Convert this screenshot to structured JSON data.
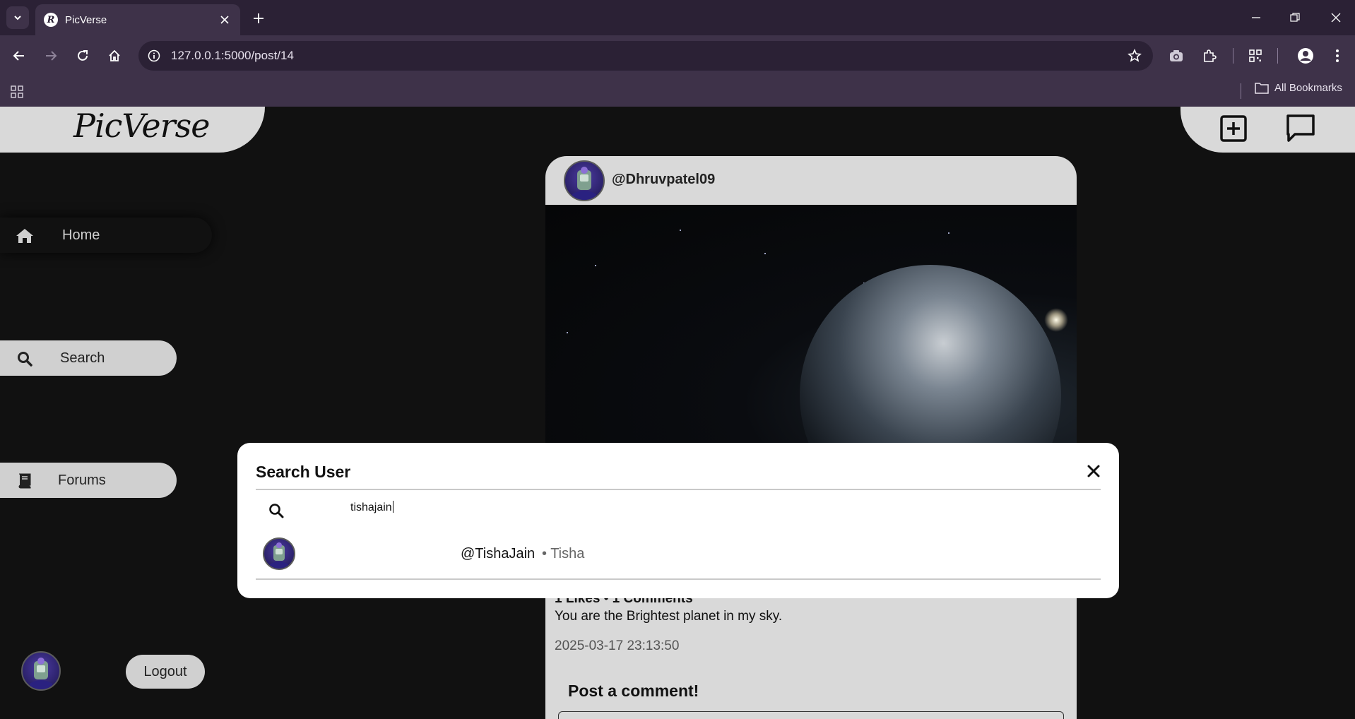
{
  "browser": {
    "tab_title": "PicVerse",
    "url": "127.0.0.1:5000/post/14",
    "all_bookmarks": "All Bookmarks"
  },
  "app": {
    "logo": "PicVerse",
    "nav": {
      "home": "Home",
      "search": "Search",
      "forums": "Forums"
    },
    "logout": "Logout"
  },
  "post": {
    "username": "@Dhruvpatel09",
    "counts": "1 Likes • 1 Comments",
    "caption": "You are the Brightest planet in my sky.",
    "date": "2025-03-17 23:13:50",
    "comment_title": "Post a comment!"
  },
  "search_modal": {
    "title": "Search User",
    "query": "tishajain",
    "results": [
      {
        "handle": "@TishaJain",
        "name": "• Tisha"
      }
    ]
  }
}
